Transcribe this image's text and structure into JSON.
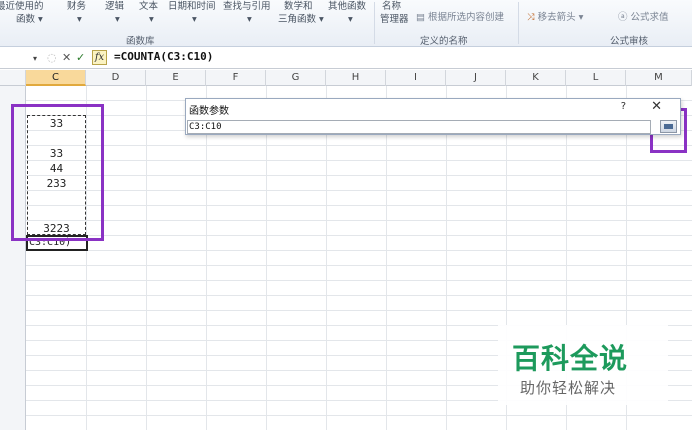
{
  "ribbon": {
    "items": [
      {
        "label": "最近使用的",
        "sub": "函数 ▾"
      },
      {
        "label": "财务",
        "sub": "▾"
      },
      {
        "label": "逻辑",
        "sub": "▾"
      },
      {
        "label": "文本",
        "sub": "▾"
      },
      {
        "label": "日期和时间",
        "sub": "▾"
      },
      {
        "label": "查找与引用",
        "sub": "▾"
      },
      {
        "label": "数学和",
        "sub": "三角函数 ▾"
      },
      {
        "label": "其他函数",
        "sub": "▾"
      },
      {
        "label": "名称",
        "sub": "管理器"
      }
    ],
    "define_from_selection": "根据所选内容创建",
    "remove_arrows": "移去箭头 ▾",
    "evaluate_formula": "公式求值",
    "groups": {
      "function_library": "函数库",
      "defined_names": "定义的名称",
      "formula_auditing": "公式审核"
    }
  },
  "formula_bar": {
    "cancel_icon": "✕",
    "enter_icon": "✓",
    "fx_label": "fx",
    "formula": "=COUNTA(C3:C10)"
  },
  "columns": [
    "C",
    "D",
    "E",
    "F",
    "G",
    "H",
    "I",
    "J",
    "K",
    "L",
    "M"
  ],
  "selected_column": "C",
  "cells": [
    {
      "id": "c3",
      "value": "33"
    },
    {
      "id": "c5",
      "value": "33"
    },
    {
      "id": "c6",
      "value": "44"
    },
    {
      "id": "c7",
      "value": "233"
    },
    {
      "id": "c10",
      "value": "3223"
    }
  ],
  "active_cell_text": "C3:C10)",
  "dialog": {
    "title": "函数参数",
    "help": "?",
    "close": "✕",
    "input_value": "C3:C10"
  },
  "watermark": {
    "title": "百科全说",
    "subtitle": "助你轻松解决"
  },
  "colors": {
    "highlight": "#8a32c4",
    "selected_header": "#f9d99b",
    "watermark_green": "#1d9a5c"
  }
}
